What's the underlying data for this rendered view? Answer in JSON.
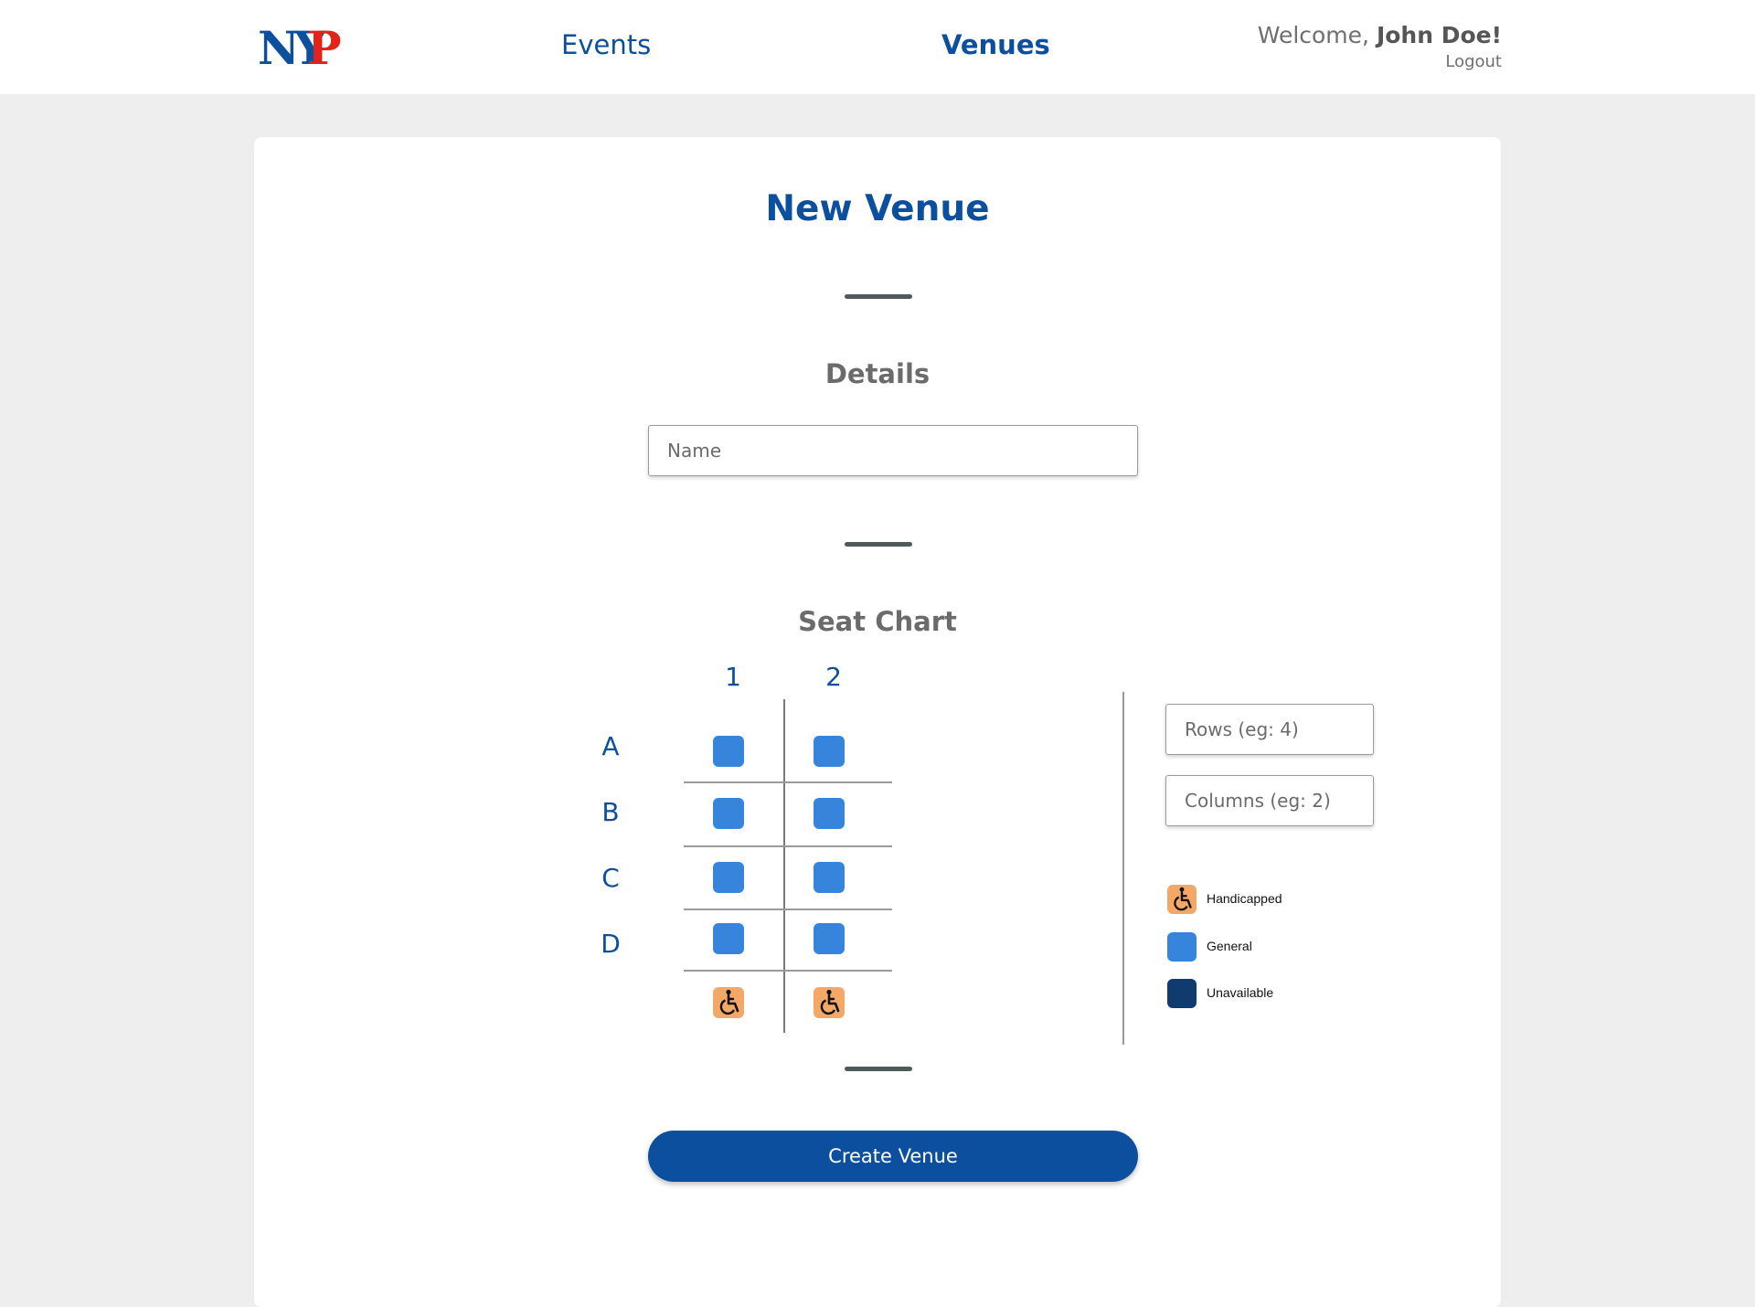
{
  "header": {
    "logo_text": "NYP",
    "nav": {
      "events": "Events",
      "venues": "Venues"
    },
    "welcome_prefix": "Welcome, ",
    "user_name": "John Doe!",
    "logout": "Logout"
  },
  "page": {
    "title": "New Venue",
    "details_title": "Details",
    "name_placeholder": "Name",
    "seat_chart_title": "Seat Chart",
    "rows_placeholder": "Rows (eg: 4)",
    "columns_placeholder": "Columns (eg: 2)",
    "create_button": "Create Venue"
  },
  "seat_chart": {
    "columns": [
      "1",
      "2"
    ],
    "rows": [
      "A",
      "B",
      "C",
      "D"
    ],
    "seat_type": "general",
    "extra_row_type": "handicapped"
  },
  "legend": [
    {
      "label": "Handicapped",
      "color": "#f4a867",
      "icon": "wheelchair-icon"
    },
    {
      "label": "General",
      "color": "#3684dc"
    },
    {
      "label": "Unavailable",
      "color": "#0f3b6e"
    }
  ],
  "colors": {
    "brand_blue": "#0b4f9e",
    "logo_red": "#e2231a",
    "seat_general": "#3684dc",
    "seat_handicapped": "#f4a867",
    "seat_unavailable": "#0f3b6e"
  }
}
